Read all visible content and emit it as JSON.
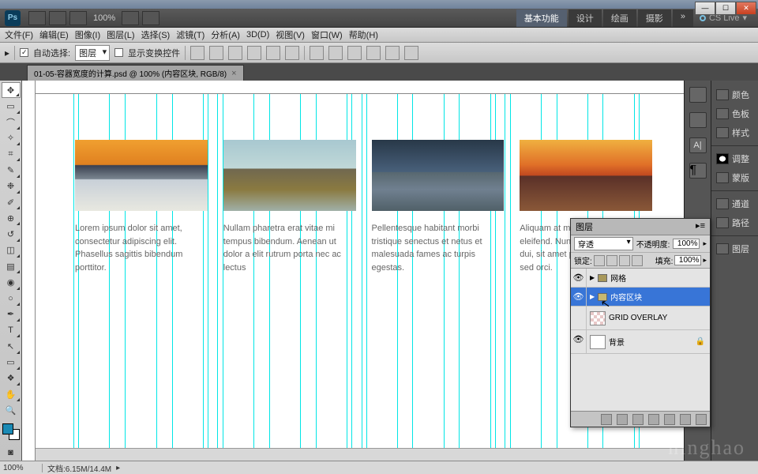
{
  "window": {
    "min": "—",
    "max": "☐",
    "close": "✕"
  },
  "top": {
    "logo": "Ps",
    "zoom": "100%",
    "tabs": [
      "基本功能",
      "设计",
      "绘画",
      "摄影"
    ],
    "more": "»",
    "cslive": "CS Live"
  },
  "menu": [
    "文件(F)",
    "编辑(E)",
    "图像(I)",
    "图层(L)",
    "选择(S)",
    "滤镜(T)",
    "分析(A)",
    "3D(D)",
    "视图(V)",
    "窗口(W)",
    "帮助(H)"
  ],
  "options": {
    "autoSelect": "自动选择:",
    "autoSelectMode": "图层",
    "showTransform": "显示变换控件"
  },
  "doc": {
    "tabTitle": "01-05-容器宽度的计算.psd @ 100% (内容区块, RGB/8)",
    "close": "×"
  },
  "cards": [
    {
      "text": "Lorem ipsum dolor sit amet, consectetur adipiscing elit. Phasellus sagittis bibendum porttitor."
    },
    {
      "text": "Nullam pharetra erat vitae mi tempus bibendum. Aenean ut dolor a elit rutrum porta nec ac lectus"
    },
    {
      "text": "Pellentesque habitant morbi tristique senectus et netus et malesuada fames ac turpis egestas."
    },
    {
      "text": "Aliquam at mi ut lorem consequat eleifend. Nunc dui mi, dignissim dui, sit amet posuere urna lectus sed orci."
    }
  ],
  "rightDock": [
    "颜色",
    "色板",
    "样式",
    "调整",
    "蒙版",
    "通道",
    "路径",
    "图层"
  ],
  "layersPanel": {
    "tab": "图层",
    "blendMode": "穿透",
    "opacityLabel": "不透明度:",
    "opacity": "100%",
    "lockLabel": "锁定:",
    "fillLabel": "填充:",
    "fill": "100%",
    "layers": [
      {
        "name": "网格",
        "type": "group",
        "visible": true
      },
      {
        "name": "内容区块",
        "type": "group",
        "visible": true,
        "selected": true
      },
      {
        "name": "GRID OVERLAY",
        "type": "layer",
        "visible": false,
        "thumb": "grid"
      },
      {
        "name": "背景",
        "type": "layer",
        "visible": true,
        "locked": true
      }
    ]
  },
  "status": {
    "zoom": "100%",
    "doc": "文档:6.15M/14.4M"
  },
  "watermark": "ninghao"
}
